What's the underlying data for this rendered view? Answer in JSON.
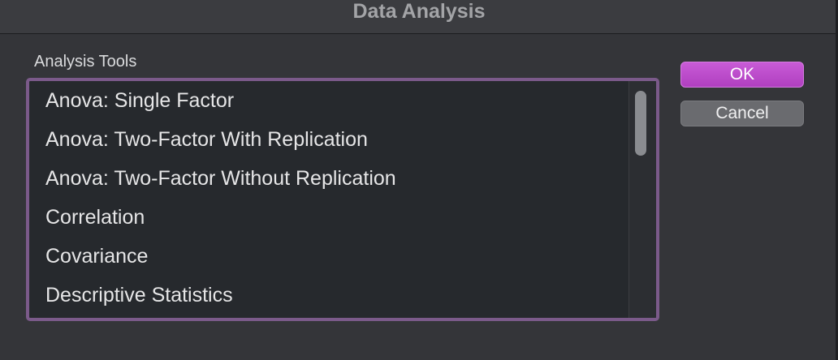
{
  "window": {
    "title": "Data Analysis"
  },
  "analysis_tools": {
    "label": "Analysis Tools",
    "items": [
      "Anova: Single Factor",
      "Anova: Two-Factor With Replication",
      "Anova: Two-Factor Without Replication",
      "Correlation",
      "Covariance",
      "Descriptive Statistics"
    ]
  },
  "buttons": {
    "ok_label": "OK",
    "cancel_label": "Cancel"
  },
  "colors": {
    "accent": "#b03fc0",
    "list_focus_ring": "#7b5a8a"
  }
}
